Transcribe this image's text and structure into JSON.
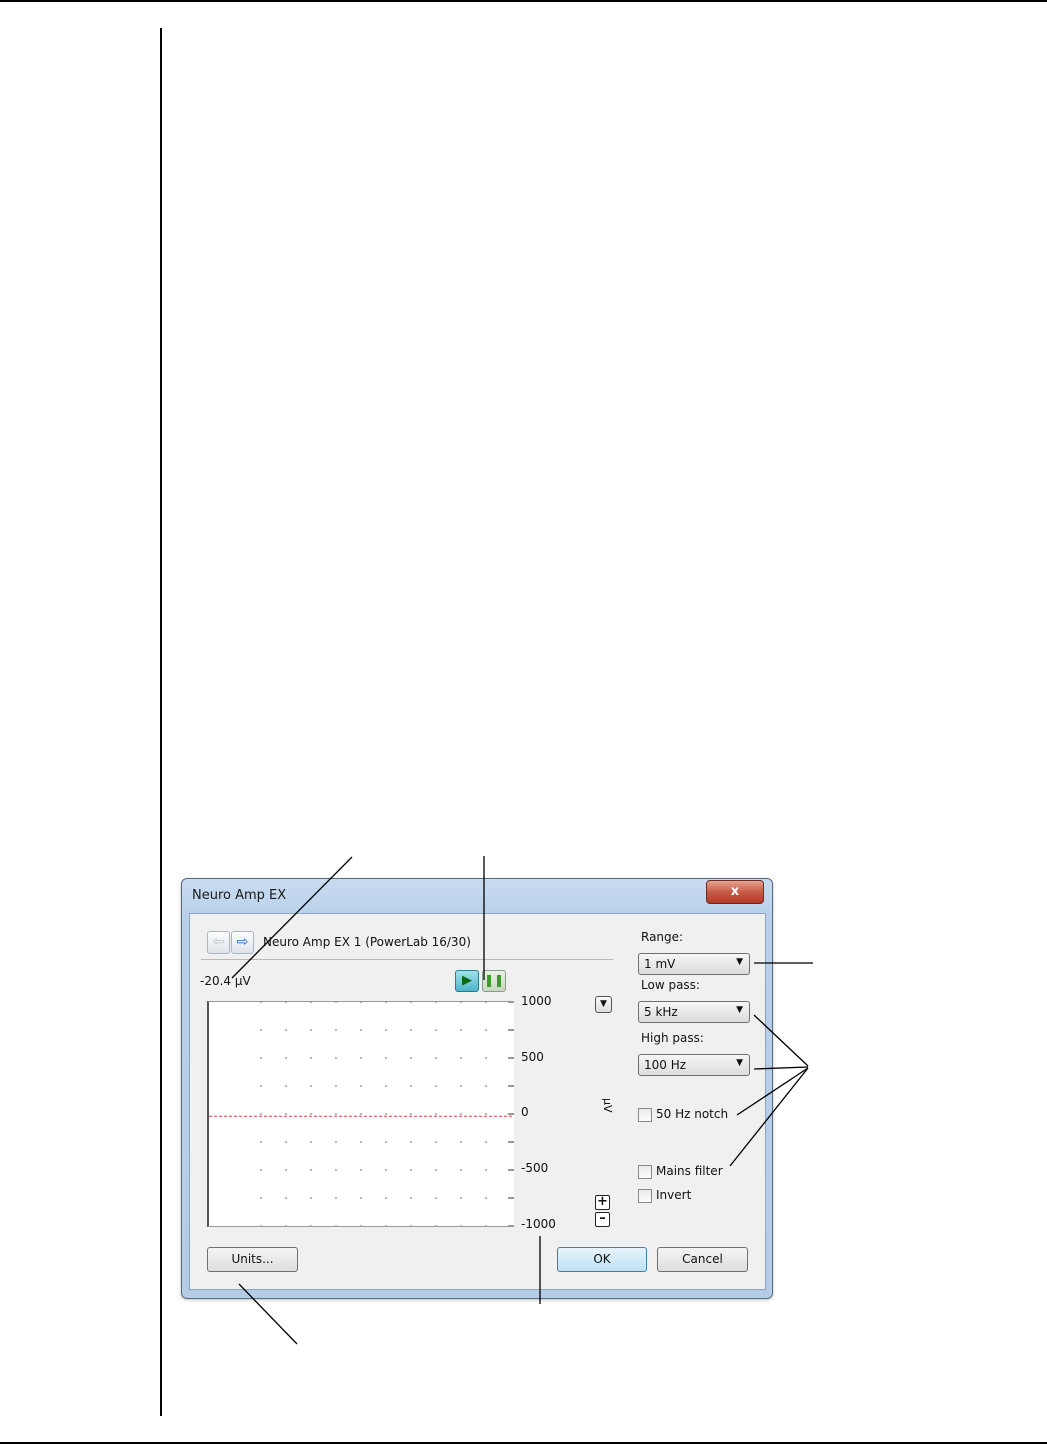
{
  "window": {
    "title": "Neuro Amp EX",
    "close_glyph": "x"
  },
  "device": {
    "name": "Neuro Amp EX 1 (PowerLab 16/30)",
    "readout": "-20.4 µV",
    "back_icon": "arrow-left-icon",
    "forward_icon": "arrow-right-icon"
  },
  "playback": {
    "play_icon": "play-icon",
    "pause_icon": "pause-icon"
  },
  "signal_plot": {
    "y_ticks": [
      "1000",
      "500",
      "0",
      "-500",
      "-1000"
    ],
    "ylim": [
      -1000,
      1000
    ],
    "units": "µV",
    "trace_color": "#e04040",
    "trace_value": -20.4
  },
  "settings": {
    "range_label": "Range:",
    "range_value": "1 mV",
    "low_pass_label": "Low pass:",
    "low_pass_value": "5 kHz",
    "high_pass_label": "High pass:",
    "high_pass_value": "100 Hz",
    "notch_label": "50 Hz notch",
    "mains_label": "Mains filter",
    "invert_label": "Invert"
  },
  "buttons": {
    "units": "Units...",
    "ok": "OK",
    "cancel": "Cancel"
  }
}
